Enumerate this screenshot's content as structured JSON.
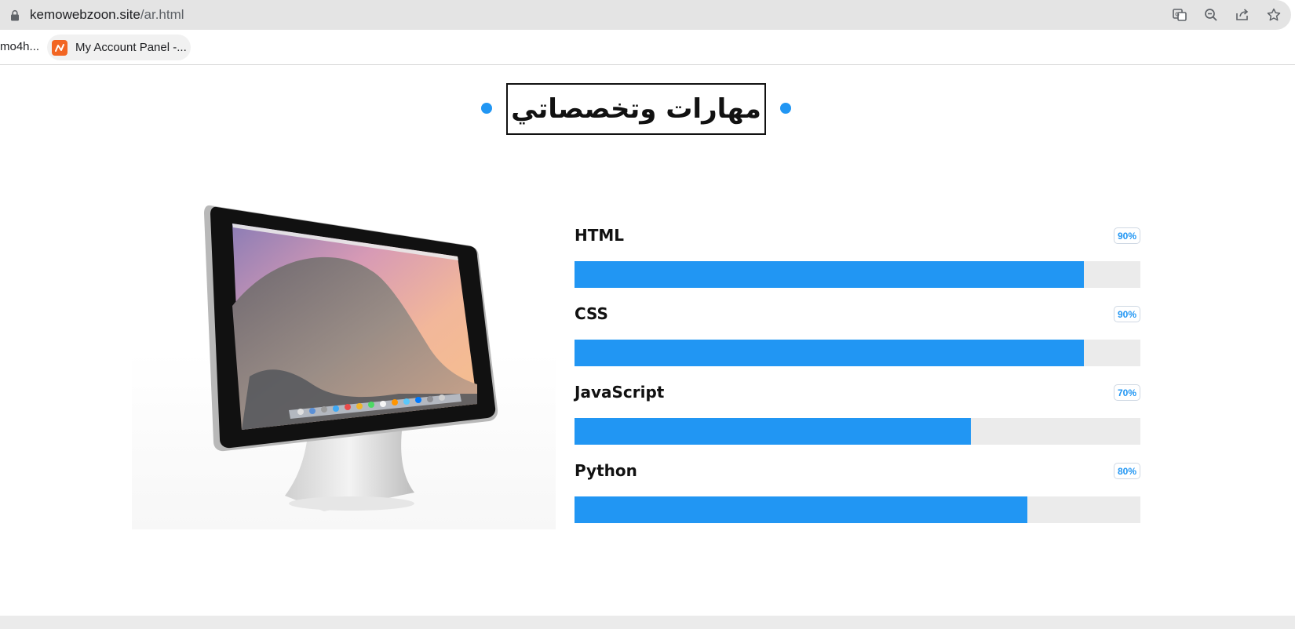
{
  "browser": {
    "url_host": "kemowebzoon.site",
    "url_path": "/ar.html",
    "bookmarks": {
      "partial_label": "mo4h...",
      "account_panel_label": "My Account Panel -..."
    },
    "icons": [
      "translate-icon",
      "zoom-out-icon",
      "share-icon",
      "bookmark-star-icon"
    ]
  },
  "section": {
    "title": "مهارات وتخصصاتي"
  },
  "skills": [
    {
      "name": "HTML",
      "percent_label": "90%",
      "percent": 90
    },
    {
      "name": "CSS",
      "percent_label": "90%",
      "percent": 90
    },
    {
      "name": "JavaScript",
      "percent_label": "70%",
      "percent": 70
    },
    {
      "name": "Python",
      "percent_label": "80%",
      "percent": 80
    }
  ],
  "colors": {
    "accent": "#2196f3",
    "track": "#ebebeb",
    "favicon": "#f26522"
  }
}
